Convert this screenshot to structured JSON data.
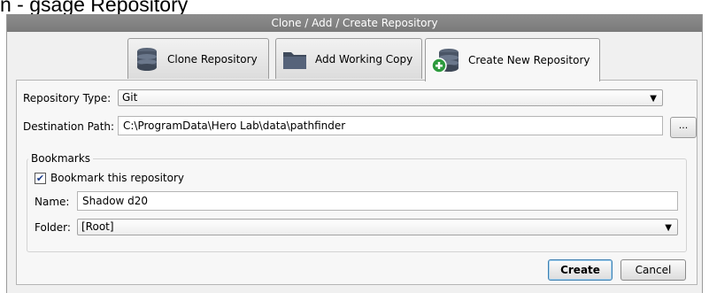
{
  "page": {
    "heading": "n - gsage Repository"
  },
  "window": {
    "title": "Clone / Add / Create Repository"
  },
  "tabs": [
    {
      "label": "Clone Repository",
      "icon": "database-icon"
    },
    {
      "label": "Add Working Copy",
      "icon": "folder-icon"
    },
    {
      "label": "Create New Repository",
      "icon": "database-add-icon",
      "active": true
    }
  ],
  "form": {
    "repo_type_label": "Repository Type:",
    "repo_type_value": "Git",
    "dest_label": "Destination Path:",
    "dest_value": "C:\\ProgramData\\Hero Lab\\data\\pathfinder",
    "browse_label": "..."
  },
  "bookmarks": {
    "legend": "Bookmarks",
    "checkbox_label": "Bookmark this repository",
    "checked": true,
    "name_label": "Name:",
    "name_value": "Shadow d20",
    "folder_label": "Folder:",
    "folder_value": "[Root]"
  },
  "buttons": {
    "create": "Create",
    "cancel": "Cancel"
  },
  "colors": {
    "titlebar": "#858585",
    "default_button_border": "#3c7fb1",
    "add_badge": "#2e9a3e"
  }
}
